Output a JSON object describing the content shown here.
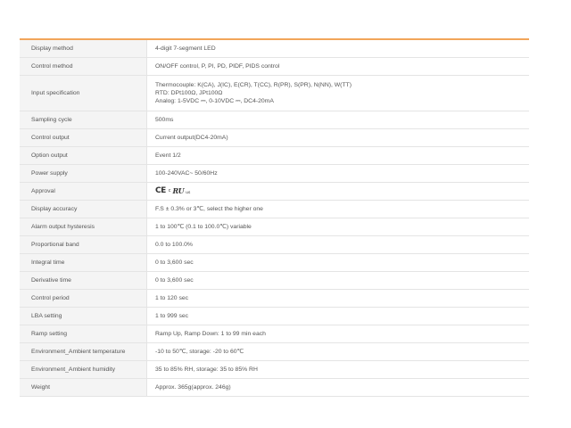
{
  "accent_color": "#f2a55a",
  "specs": [
    {
      "label": "Display method",
      "value": "4-digit 7-segment LED"
    },
    {
      "label": "Control method",
      "value": "ON/OFF control, P, PI, PD, PIDF, PIDS control"
    },
    {
      "label": "Input specification",
      "lines": [
        "Thermocouple: K(CA), J(IC), E(CR), T(CC), R(PR), S(PR), N(NN), W(TT)",
        "RTD: DPt100Ω, JPt100Ω",
        "Analog: 1-5VDC ⎓, 0-10VDC ⎓, DC4-20mA"
      ]
    },
    {
      "label": "Sampling cycle",
      "value": "500ms"
    },
    {
      "label": "Control output",
      "value": "Current output(DC4-20mA)"
    },
    {
      "label": "Option output",
      "value": "Event 1/2"
    },
    {
      "label": "Power supply",
      "value": "100-240VAC~ 50/60Hz"
    },
    {
      "label": "Approval",
      "marks": {
        "ce": "CE",
        "c": "c",
        "ur": "RU",
        "us": "us"
      }
    },
    {
      "label": "Display accuracy",
      "value": "F.S ± 0.3% or 3℃, select the higher one"
    },
    {
      "label": "Alarm output hysteresis",
      "value": "1 to 100℃ (0.1 to 100.0℃) variable"
    },
    {
      "label": "Proportional band",
      "value": "0.0 to 100.0%"
    },
    {
      "label": "Integral time",
      "value": "0 to 3,600 sec"
    },
    {
      "label": "Derivative time",
      "value": "0 to 3,600 sec"
    },
    {
      "label": "Control period",
      "value": "1 to 120 sec"
    },
    {
      "label": "LBA setting",
      "value": "1 to 999 sec"
    },
    {
      "label": "Ramp setting",
      "value": "Ramp Up, Ramp Down: 1 to 99 min each"
    },
    {
      "label": "Environment_Ambient temperature",
      "value": "-10 to 50℃, storage: -20 to 60℃"
    },
    {
      "label": "Environment_Ambient humidity",
      "value": "35 to 85% RH, storage: 35 to 85% RH"
    },
    {
      "label": "Weight",
      "value": "Approx. 365g(approx. 246g)"
    }
  ]
}
